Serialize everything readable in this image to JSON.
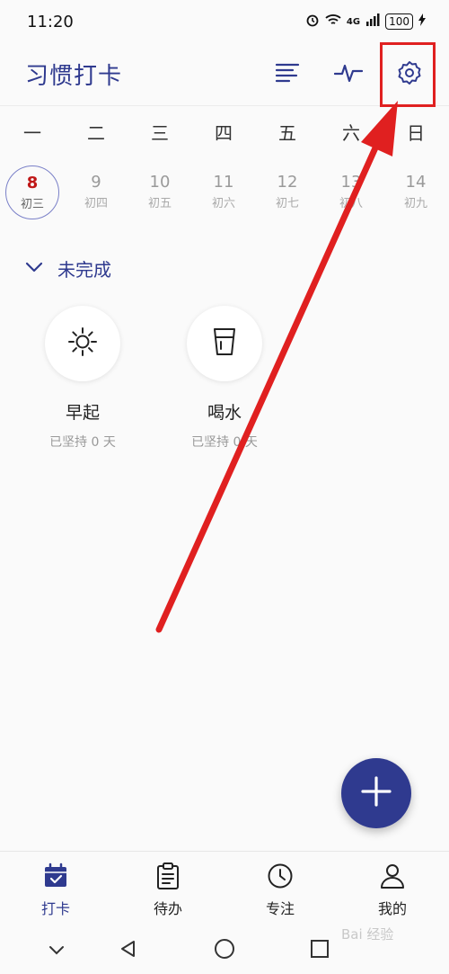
{
  "status": {
    "time": "11:20",
    "signal": "4G",
    "battery": "100"
  },
  "header": {
    "title": "习惯打卡"
  },
  "week": {
    "days": [
      "一",
      "二",
      "三",
      "四",
      "五",
      "六",
      "日"
    ]
  },
  "dates": [
    {
      "num": "8",
      "lunar": "初三"
    },
    {
      "num": "9",
      "lunar": "初四"
    },
    {
      "num": "10",
      "lunar": "初五"
    },
    {
      "num": "11",
      "lunar": "初六"
    },
    {
      "num": "12",
      "lunar": "初七"
    },
    {
      "num": "13",
      "lunar": "初八"
    },
    {
      "num": "14",
      "lunar": "初九"
    }
  ],
  "section": {
    "title": "未完成"
  },
  "habits": [
    {
      "name": "早起",
      "days": "已坚持 0 天",
      "icon": "sun-icon"
    },
    {
      "name": "喝水",
      "days": "已坚持 0 天",
      "icon": "cup-icon"
    }
  ],
  "nav": [
    {
      "label": "打卡",
      "icon": "calendar-check-icon"
    },
    {
      "label": "待办",
      "icon": "clipboard-icon"
    },
    {
      "label": "专注",
      "icon": "clock-icon"
    },
    {
      "label": "我的",
      "icon": "person-icon"
    }
  ],
  "watermark": "Bai 经验",
  "colors": {
    "accent": "#2f3a8f",
    "today": "#c01818",
    "annotation": "#e02020"
  }
}
